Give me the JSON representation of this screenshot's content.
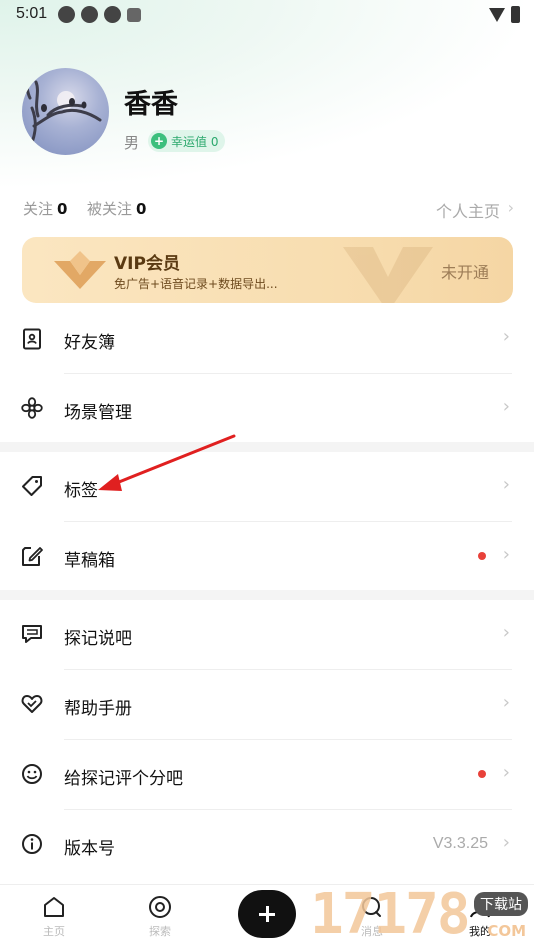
{
  "status_bar": {
    "time": "5:01"
  },
  "profile": {
    "username": "香香",
    "gender": "男",
    "luck_label": "幸运值 0",
    "luck_icon": "+",
    "following_label": "关注",
    "following_count": "0",
    "followers_label": "被关注",
    "followers_count": "0",
    "homepage_link": "个人主页",
    "chevron": "›"
  },
  "vip": {
    "title": "VIP会员",
    "description": "免广告+语音记录+数据导出...",
    "status": "未开通"
  },
  "menu": [
    {
      "label": "好友簿",
      "icon": "contact-book-icon"
    },
    {
      "label": "场景管理",
      "icon": "flower-icon"
    },
    {
      "label": "标签",
      "icon": "tag-icon"
    },
    {
      "label": "草稿箱",
      "icon": "draft-icon",
      "has_dot": true
    },
    {
      "label": "探记说吧",
      "icon": "chat-icon"
    },
    {
      "label": "帮助手册",
      "icon": "heart-handshake-icon"
    },
    {
      "label": "给探记评个分吧",
      "icon": "smile-icon",
      "has_dot": true
    },
    {
      "label": "版本号",
      "icon": "info-icon",
      "value": "V3.3.25"
    }
  ],
  "tabbar": {
    "home": "主页",
    "explore": "探索",
    "message": "消息",
    "mine": "我的"
  },
  "watermark": {
    "number": "17178",
    "badge": "下载站",
    "domain": "COM"
  },
  "colors": {
    "accent_green": "#3cbf7d",
    "vip_gold": "#f8deb1",
    "dot_red": "#e8413a",
    "annotation_arrow": "#e02020"
  }
}
